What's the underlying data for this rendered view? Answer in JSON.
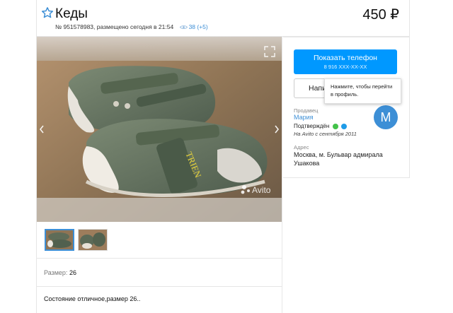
{
  "header": {
    "title": "Кеды",
    "price": "450 ₽",
    "ad_info": "№ 951578983, размещено сегодня в 21:54",
    "views": "38 (+5)"
  },
  "details": {
    "size_label": "Размер:",
    "size_value": "26",
    "description": "Состояние отличное,размер 26.."
  },
  "contact": {
    "phone_button": "Показать телефон",
    "phone_masked": "8 916 XXX-XX-XX",
    "write_button": "Напи",
    "tooltip": "Нажмите, чтобы перейти в профиль."
  },
  "seller": {
    "label": "Продавец",
    "name": "Мария",
    "confirmed": "Подтверждён",
    "since": "На Avito с сентября 2011",
    "avatar_letter": "M",
    "address_label": "Адрес",
    "address": "Москва, м. Бульвар адмирала Ушакова"
  },
  "gallery": {
    "watermark": "Avito",
    "shoe_text": "TRIEN"
  },
  "colors": {
    "accent": "#0098ff",
    "link": "#3d8fd6",
    "phone_icon": "#43c24a",
    "service_icon": "#1e9be8"
  },
  "icons": {
    "favorite": "star-outline-icon",
    "views": "eye-icon",
    "fullscreen": "expand-icon",
    "prev": "chevron-left-icon",
    "next": "chevron-right-icon"
  }
}
